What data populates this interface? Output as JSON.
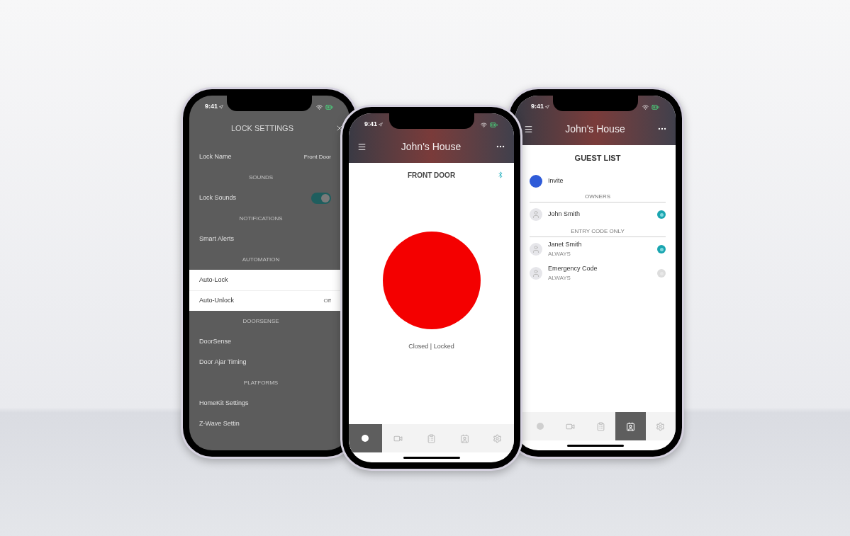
{
  "phones": [
    {
      "kind": "settings",
      "status_time": "9:41",
      "title": "LOCK SETTINGS",
      "sections": [
        {
          "rows": [
            {
              "kind": "value",
              "label": "Lock Name",
              "value": "Front Door"
            }
          ]
        },
        {
          "header": "SOUNDS",
          "highlighted": false,
          "rows": [
            {
              "kind": "toggle",
              "label": "Lock Sounds",
              "on": true
            }
          ]
        },
        {
          "header": "NOTIFICATIONS",
          "highlighted": false,
          "rows": [
            {
              "kind": "link",
              "label": "Smart Alerts"
            }
          ]
        },
        {
          "header": "AUTOMATION",
          "highlighted": true,
          "rows": [
            {
              "kind": "link",
              "label": "Auto-Lock"
            },
            {
              "kind": "value",
              "label": "Auto-Unlock",
              "value": "Off"
            }
          ]
        },
        {
          "header": "DOORSENSE",
          "highlighted": false,
          "rows": [
            {
              "kind": "link",
              "label": "DoorSense"
            },
            {
              "kind": "link",
              "label": "Door Ajar Timing"
            }
          ]
        },
        {
          "header": "PLATFORMS",
          "highlighted": false,
          "rows": [
            {
              "kind": "link",
              "label": "HomeKit Settings"
            },
            {
              "kind": "link",
              "label": "Z-Wave Settin"
            }
          ]
        }
      ]
    },
    {
      "kind": "lock",
      "status_time": "9:41",
      "house": "John's House",
      "lock_name": "FRONT DOOR",
      "locked": true,
      "status": "Closed | Locked",
      "tabs": [
        {
          "kind": "lock",
          "selected": true
        },
        {
          "kind": "camera",
          "selected": false
        },
        {
          "kind": "activity",
          "selected": false
        },
        {
          "kind": "guests",
          "selected": false
        },
        {
          "kind": "settings",
          "selected": false
        }
      ]
    },
    {
      "kind": "guests",
      "status_time": "9:41",
      "house": "John's House",
      "title": "GUEST LIST",
      "invite": "Invite",
      "groups": [
        {
          "header": "OWNERS",
          "guests": [
            {
              "name": "John Smith",
              "active": true
            }
          ]
        },
        {
          "header": "ENTRY CODE ONLY",
          "guests": [
            {
              "name": "Janet Smith",
              "schedule": "ALWAYS",
              "active": true
            },
            {
              "name": "Emergency Code",
              "schedule": "ALWAYS",
              "active": false
            }
          ]
        }
      ],
      "tabs": [
        {
          "kind": "lock",
          "selected": false
        },
        {
          "kind": "camera",
          "selected": false
        },
        {
          "kind": "activity",
          "selected": false
        },
        {
          "kind": "guests",
          "selected": true
        },
        {
          "kind": "settings",
          "selected": false
        }
      ]
    }
  ]
}
